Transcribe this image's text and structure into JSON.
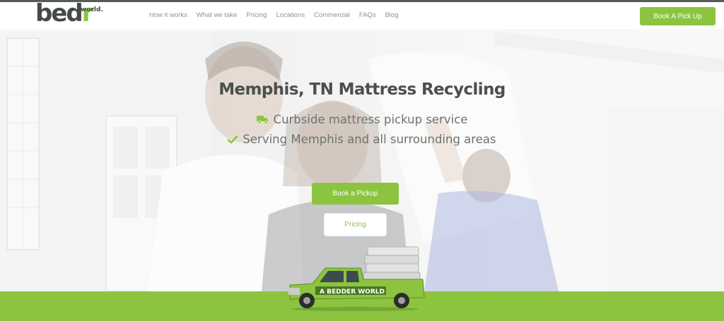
{
  "brand": {
    "logo_text_main": "bed",
    "logo_text_accent": "r",
    "logo_text_sub": "world."
  },
  "nav": {
    "items": [
      "How it works",
      "What we take",
      "Pricing",
      "Locations",
      "Commercial",
      "FAQs",
      "Blog"
    ],
    "cta_label": "Book A Pick Up"
  },
  "hero": {
    "title": "Memphis, TN Mattress Recycling",
    "features": [
      {
        "icon": "truck-icon",
        "text": "Curbside mattress pickup service"
      },
      {
        "icon": "checkmark-icon",
        "text": "Serving Memphis and all surrounding areas"
      }
    ],
    "primary_button": "Book a Pickup",
    "secondary_button": "Pricing"
  },
  "truck": {
    "decal_text": "A BEDDER WORLD",
    "icon": "pickup-truck-icon"
  },
  "colors": {
    "accent": "#8cc43f",
    "heading": "#4b504b",
    "text": "#6e736e",
    "nav_text": "#8e938e"
  }
}
